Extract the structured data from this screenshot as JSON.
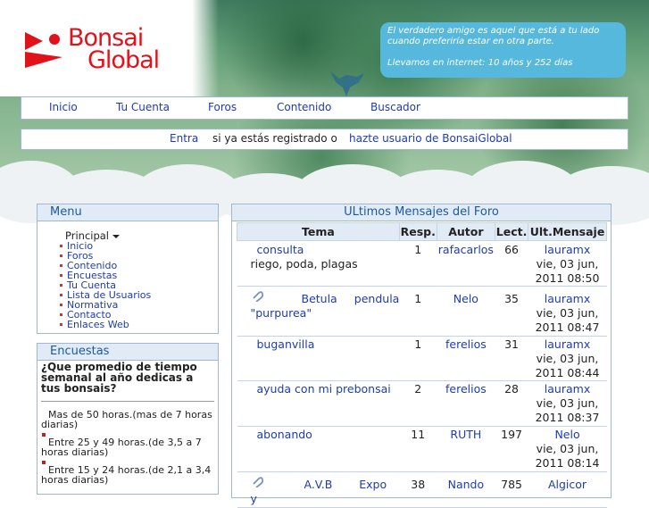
{
  "header": {
    "logo_line1": "Bonsai",
    "logo_line2": "Global",
    "quote_line1": "El verdadero amigo es aquel que está a tu lado cuando preferiría estar en otra parte.",
    "quote_line2": "Llevamos en internet: 10 años y 252 días"
  },
  "nav": {
    "items": [
      "Inicio",
      "Tu Cuenta",
      "Foros",
      "Contenido",
      "Buscador"
    ]
  },
  "login": {
    "enter": "Entra",
    "middle": "si ya estás registrado o",
    "register": "hazte usuario de BonsaiGlobal"
  },
  "menu": {
    "title": "Menu",
    "dropdown": "Principal",
    "items": [
      "Inicio",
      "Foros",
      "Contenido",
      "Encuestas",
      "Tu Cuenta",
      "Lista de Usuarios",
      "Normativa",
      "Contacto",
      "Enlaces Web"
    ]
  },
  "poll": {
    "title": "Encuestas",
    "question": "¿Que promedio de tiempo semanal al año dedicas a tus bonsais?",
    "options": [
      "Mas de 50 horas.(mas de 7 horas diarias)",
      "Entre 25 y 49 horas.(de 3,5 a 7 horas diarias)",
      "Entre 15 y 24 horas.(de 2,1 a 3,4 horas diarias)"
    ]
  },
  "forum": {
    "title": "ULtimos Mensajes del Foro",
    "columns": [
      "Tema",
      "Resp.",
      "Autor",
      "Lect.",
      "Ult.Mensaje"
    ],
    "rows": [
      {
        "topic": "consulta",
        "subtitle": "riego, poda, plagas",
        "attach": false,
        "replies": "1",
        "author": "rafacarlos",
        "reads": "66",
        "last_user": "lauramx",
        "last_date": "vie, 03 jun, 2011 08:50"
      },
      {
        "topic": "Betula pendula \"purpurea\"",
        "subtitle": "",
        "attach": true,
        "replies": "1",
        "author": "Nelo",
        "reads": "35",
        "last_user": "lauramx",
        "last_date": "vie, 03 jun, 2011 08:47"
      },
      {
        "topic": "buganvilla",
        "subtitle": "",
        "attach": false,
        "replies": "1",
        "author": "ferelios",
        "reads": "31",
        "last_user": "lauramx",
        "last_date": "vie, 03 jun, 2011 08:44"
      },
      {
        "topic": "ayuda con mi prebonsai",
        "subtitle": "",
        "attach": false,
        "replies": "2",
        "author": "ferelios",
        "reads": "28",
        "last_user": "lauramx",
        "last_date": "vie, 03 jun, 2011 08:37"
      },
      {
        "topic": "abonando",
        "subtitle": "",
        "attach": false,
        "replies": "11",
        "author": "RUTH",
        "reads": "197",
        "last_user": "Nelo",
        "last_date": "vie, 03 jun, 2011 08:14"
      },
      {
        "topic": "A.V.B Expo y",
        "subtitle": "",
        "attach": true,
        "replies": "38",
        "author": "Nando",
        "reads": "785",
        "last_user": "Algicor",
        "last_date": ""
      }
    ]
  }
}
